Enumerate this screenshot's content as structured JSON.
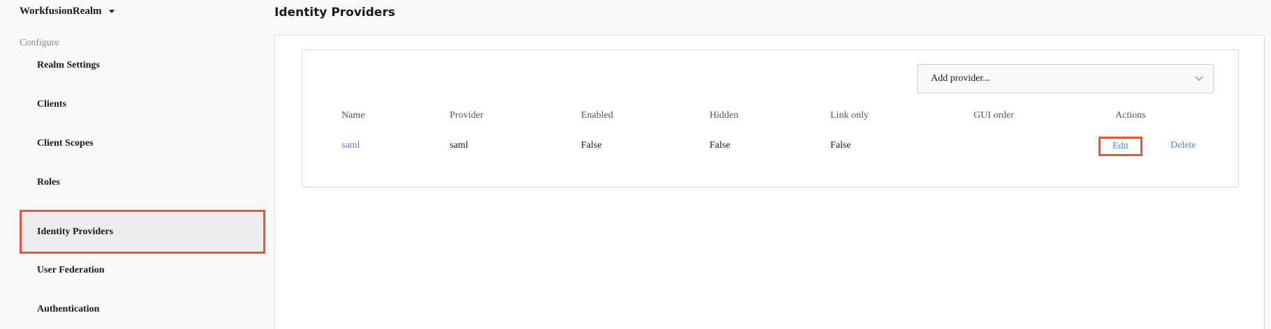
{
  "sidebar": {
    "realm_name": "WorkfusionRealm",
    "section_label": "Configure",
    "items": [
      {
        "label": "Realm Settings"
      },
      {
        "label": "Clients"
      },
      {
        "label": "Client Scopes"
      },
      {
        "label": "Roles"
      },
      {
        "label": "Identity Providers",
        "active": true
      },
      {
        "label": "User Federation"
      },
      {
        "label": "Authentication"
      }
    ]
  },
  "main": {
    "title": "Identity Providers",
    "add_provider": {
      "placeholder": "Add provider..."
    },
    "table": {
      "headers": [
        "Name",
        "Provider",
        "Enabled",
        "Hidden",
        "Link only",
        "GUI order",
        "Actions"
      ],
      "rows": [
        {
          "name": "saml",
          "provider": "saml",
          "enabled": "False",
          "hidden": "False",
          "link_only": "False",
          "gui_order": "",
          "edit_label": "Edit",
          "delete_label": "Delete"
        }
      ]
    }
  },
  "colors": {
    "accent_link": "#4a87d6",
    "highlight": "#ee5432"
  }
}
